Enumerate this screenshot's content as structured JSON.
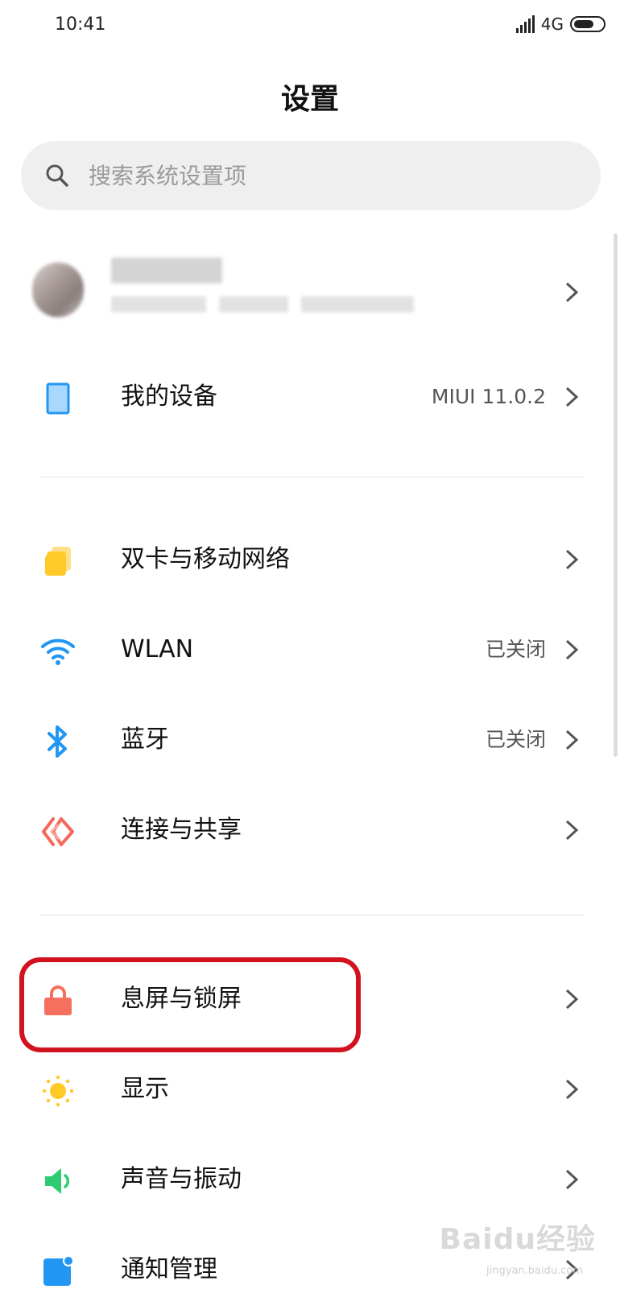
{
  "status": {
    "time": "10:41",
    "network": "4G"
  },
  "title": "设置",
  "search": {
    "placeholder": "搜索系统设置项"
  },
  "items": [
    {
      "label": "我的设备",
      "value": "MIUI 11.0.2",
      "icon": "device-icon"
    },
    {
      "label": "双卡与移动网络",
      "value": "",
      "icon": "sim-card-icon"
    },
    {
      "label": "WLAN",
      "value": "已关闭",
      "icon": "wifi-icon"
    },
    {
      "label": "蓝牙",
      "value": "已关闭",
      "icon": "bluetooth-icon"
    },
    {
      "label": "连接与共享",
      "value": "",
      "icon": "connection-share-icon"
    },
    {
      "label": "息屏与锁屏",
      "value": "",
      "icon": "lock-icon"
    },
    {
      "label": "显示",
      "value": "",
      "icon": "sun-icon"
    },
    {
      "label": "声音与振动",
      "value": "",
      "icon": "speaker-icon"
    },
    {
      "label": "通知管理",
      "value": "",
      "icon": "notification-icon"
    }
  ],
  "colors": {
    "accent_blue": "#2196f3",
    "sim_yellow": "#ffc928",
    "connect_coral": "#f26b5b",
    "lock_coral": "#f5705f",
    "sun_yellow": "#ffc928",
    "sound_green": "#2ecc71",
    "highlight_red": "#d3121f"
  },
  "watermark": {
    "text": "Baidu经验",
    "sub": "jingyan.baidu.com"
  }
}
